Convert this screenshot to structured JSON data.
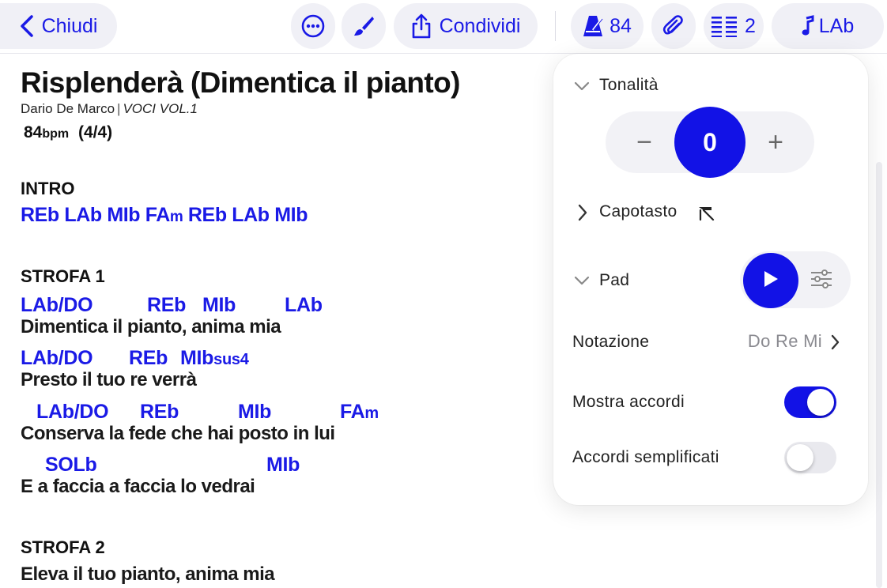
{
  "toolbar": {
    "close_label": "Chiudi",
    "share_label": "Condividi",
    "bpm": "84",
    "columns": "2",
    "key_label": "LAb"
  },
  "song": {
    "title": "Risplenderà (Dimentica il pianto)",
    "artist": "Dario De Marco",
    "album": "VOCI VOL.1",
    "bpm": "84",
    "bpm_unit": "bpm",
    "time_signature": "(4/4)"
  },
  "sections": {
    "intro": {
      "name": "INTRO",
      "chords": [
        "REb",
        "LAb",
        "MIb",
        "FA",
        "REb",
        "LAb",
        "MIb"
      ],
      "fam_suffix": "m"
    },
    "strofa1": {
      "name": "STROFA 1",
      "lines": [
        {
          "chords": [
            "LAb/DO",
            "REb",
            "MIb",
            "LAb"
          ],
          "lyric": "Dimentica il pianto, anima mia"
        },
        {
          "chords": [
            "LAb/DO",
            "REb",
            "MIb"
          ],
          "chord_suffix": "sus4",
          "lyric": "Presto il tuo re verrà"
        },
        {
          "chords": [
            "LAb/DO",
            "REb",
            "MIb",
            "FA"
          ],
          "chord_suffix": "m",
          "lyric": "Conserva la fede che hai posto in lui"
        },
        {
          "chords": [
            "SOLb",
            "MIb"
          ],
          "lyric": "E a faccia a faccia lo vedrai"
        }
      ]
    },
    "strofa2": {
      "name": "STROFA 2",
      "lines": [
        {
          "lyric": "Eleva il tuo pianto, anima mia"
        }
      ]
    }
  },
  "panel": {
    "tonalita_label": "Tonalità",
    "transpose_value": "0",
    "minus": "−",
    "plus": "+",
    "capotasto_label": "Capotasto",
    "pad_label": "Pad",
    "notazione_label": "Notazione",
    "notazione_value": "Do Re Mi",
    "mostra_accordi_label": "Mostra accordi",
    "mostra_accordi_on": true,
    "accordi_semplificati_label": "Accordi semplificati",
    "accordi_semplificati_on": false
  },
  "colors": {
    "accent": "#1212e6",
    "chord": "#1a1ae6",
    "pill_bg": "#f0f0f6"
  },
  "icons": [
    "chevron-left-icon",
    "more-icon",
    "brush-icon",
    "share-icon",
    "metronome-icon",
    "paperclip-icon",
    "columns-icon",
    "music-note-icon",
    "chevron-down-icon",
    "chevron-right-icon",
    "capo-icon",
    "play-icon",
    "sliders-icon"
  ]
}
